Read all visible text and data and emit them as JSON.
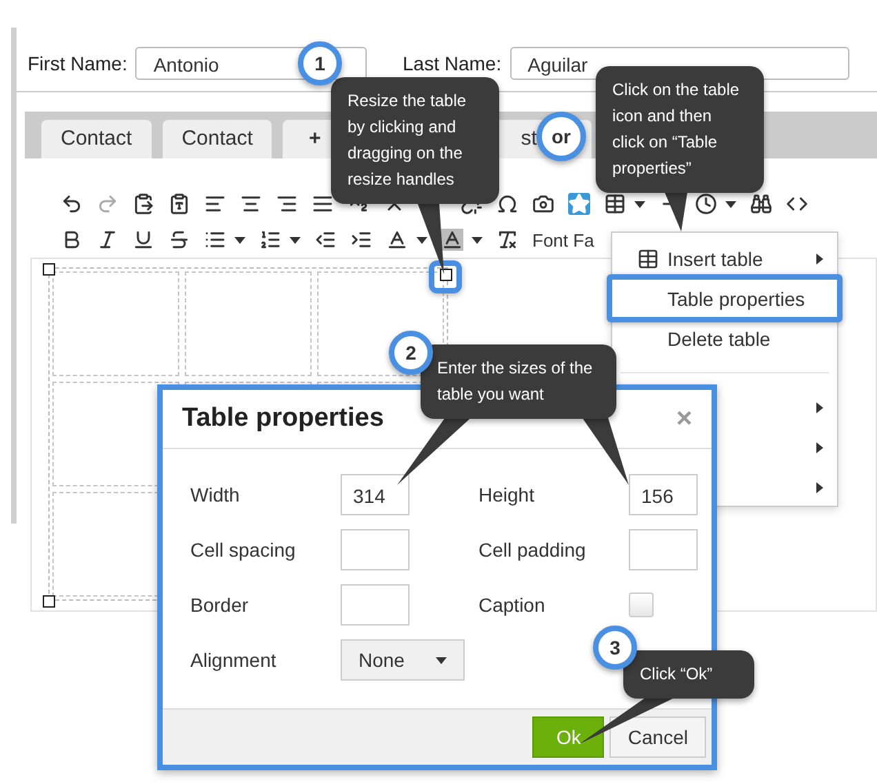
{
  "form": {
    "fields": [
      {
        "label": "First Name:",
        "value": "Antonio"
      },
      {
        "label": "Last Name:",
        "value": "Aguilar"
      }
    ]
  },
  "tabs": [
    {
      "label": "Contact"
    },
    {
      "label": "Contact"
    },
    {
      "label": "+"
    },
    {
      "label": "st"
    }
  ],
  "toolbar": {
    "font_menu": "Font Fa"
  },
  "context_menu": {
    "items": [
      {
        "label": "Insert table",
        "submenu": true,
        "annotated": false
      },
      {
        "label": "Table properties",
        "submenu": false,
        "annotated": true
      },
      {
        "label": "Delete table",
        "submenu": false,
        "annotated": false
      },
      {
        "kind": "separator"
      },
      {
        "submenu": true,
        "annotated": false
      },
      {
        "submenu": true,
        "annotated": false
      },
      {
        "submenu": true,
        "annotated": false
      }
    ]
  },
  "dialog": {
    "title": "Table properties",
    "close": "×",
    "fields": [
      {
        "kind": "text",
        "label": "Width",
        "value": "314"
      },
      {
        "kind": "text",
        "label": "Height",
        "value": "156"
      },
      {
        "kind": "text",
        "label": "Cell spacing"
      },
      {
        "kind": "text",
        "label": "Cell padding"
      },
      {
        "kind": "text",
        "label": "Border"
      },
      {
        "kind": "checkbox",
        "label": "Caption",
        "checked": false
      },
      {
        "kind": "select",
        "label": "Alignment",
        "value": "None"
      }
    ],
    "buttons": [
      {
        "label": "Ok",
        "kind": "primary"
      },
      {
        "label": "Cancel",
        "kind": "default"
      }
    ]
  },
  "annotations": {
    "badges": [
      "1",
      "or",
      "2",
      "3"
    ],
    "callouts": [
      "Resize the table by clicking and dragging on the resize handles",
      "Click on the table icon and then click on “Table properties”",
      "Enter the sizes of the table you want",
      "Click “Ok”"
    ]
  }
}
